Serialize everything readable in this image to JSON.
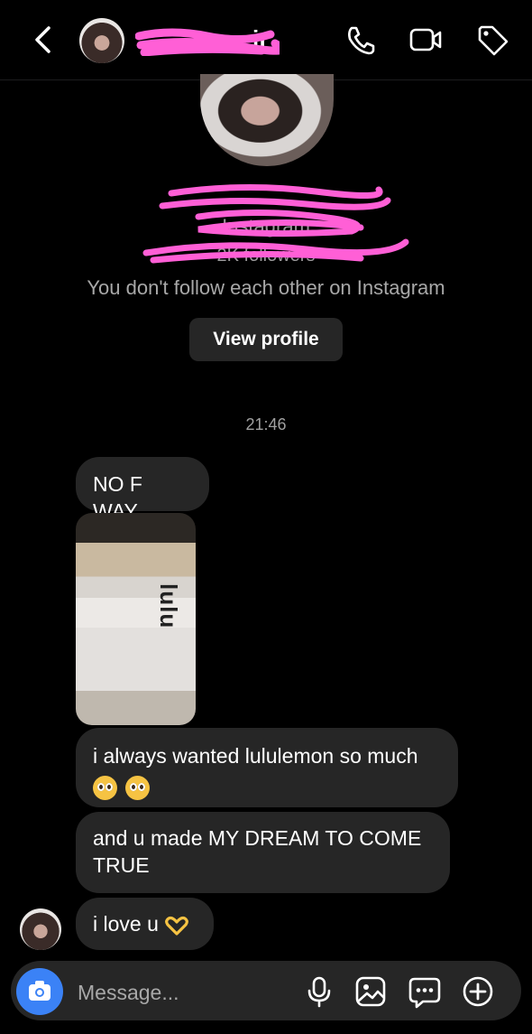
{
  "header": {
    "name_visible_fragment": "ir",
    "icons": [
      "back-chevron-icon",
      "phone-icon",
      "video-camera-icon",
      "tag-icon"
    ]
  },
  "profile": {
    "platform_line": "Instagram",
    "followers_line": "2K followers",
    "follow_note": "You don't follow each other on Instagram",
    "view_profile_label": "View profile"
  },
  "thread": {
    "timestamp": "21:46",
    "messages": [
      {
        "type": "text",
        "text": "NO F WAY"
      },
      {
        "type": "image",
        "label": "lulu"
      },
      {
        "type": "text",
        "text": "i always wanted lululemon so much"
      },
      {
        "type": "text",
        "text": "and u made MY DREAM TO COME TRUE"
      },
      {
        "type": "text",
        "text": "i love u"
      }
    ]
  },
  "composer": {
    "placeholder": "Message...",
    "icons": [
      "camera-icon",
      "microphone-icon",
      "gallery-icon",
      "sticker-icon",
      "plus-icon"
    ],
    "accent": "#3b82f6"
  }
}
